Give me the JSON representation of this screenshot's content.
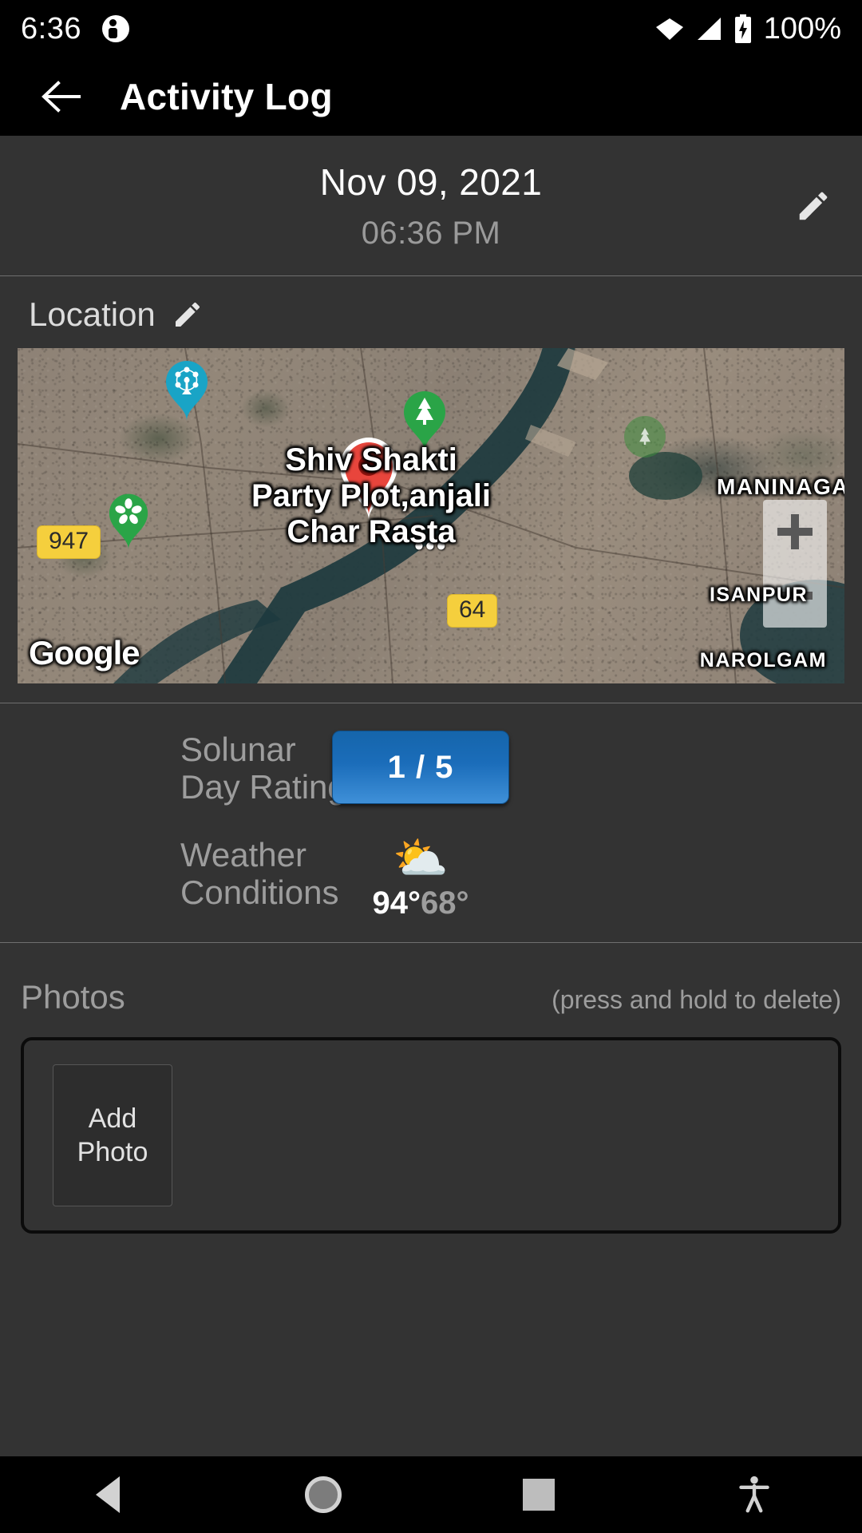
{
  "status_bar": {
    "time": "6:36",
    "battery_percent": "100%",
    "icons": [
      "notification-icon",
      "wifi-icon",
      "signal-icon",
      "battery-charging-icon"
    ]
  },
  "app_bar": {
    "back_icon": "arrow-back-icon",
    "title": "Activity Log"
  },
  "date_header": {
    "date": "Nov 09, 2021",
    "time": "06:36 PM",
    "edit_icon": "pencil-edit-icon"
  },
  "location": {
    "label": "Location",
    "edit_icon": "pencil-edit-icon",
    "map": {
      "provider_logo": "Google",
      "poi_label": "Shiv Shakti Party Plot,anjali Char Rasta",
      "area_labels": [
        "MANINAGA",
        "ISANPUR",
        "NAROLGAM"
      ],
      "road_shields": [
        "947",
        "64"
      ],
      "zoom_in_label": "+",
      "zoom_out_label": "−",
      "markers": [
        {
          "name": "selected-location-marker",
          "color": "#e8453c",
          "icon": "map-pin"
        },
        {
          "name": "amusement-park-marker",
          "color": "#19a4c6",
          "icon": "ferris-wheel"
        },
        {
          "name": "park-tree-marker",
          "color": "#2aa447",
          "icon": "tree"
        },
        {
          "name": "garden-flower-marker",
          "color": "#2aa447",
          "icon": "flower"
        }
      ]
    }
  },
  "info": {
    "solunar_label": "Solunar\nDay Rating",
    "solunar_label_line1": "Solunar",
    "solunar_label_line2": "Day Rating",
    "solunar_value": "1 / 5",
    "weather_label_line1": "Weather",
    "weather_label_line2": "Conditions",
    "weather_icon": "sun-behind-cloud-icon",
    "weather_icon_glyph": "⛅",
    "temp_high": "94°",
    "temp_low": "68°"
  },
  "photos": {
    "title": "Photos",
    "hint": "(press and hold to delete)",
    "add_photo_line1": "Add",
    "add_photo_line2": "Photo"
  },
  "nav_bar": {
    "back": "back-triangle-icon",
    "home": "home-circle-icon",
    "recents": "recents-square-icon",
    "accessibility": "accessibility-icon"
  },
  "colors": {
    "background": "#333333",
    "bar_background": "#000000",
    "accent_blue": "#1b6dba",
    "muted_text": "#9d9d9d",
    "divider": "#6f6f6f"
  }
}
